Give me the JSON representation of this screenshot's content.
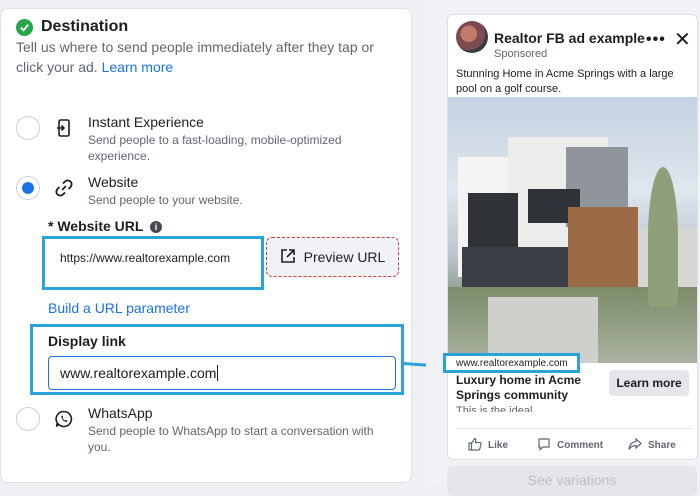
{
  "destination": {
    "title": "Destination",
    "description": "Tell us where to send people immediately after they tap or click your ad.",
    "learn_more": "Learn more"
  },
  "options": [
    {
      "label": "Instant Experience",
      "sub": "Send people to a fast-loading, mobile-optimized experience.",
      "icon": "instant-experience-icon",
      "selected": false
    },
    {
      "label": "Website",
      "sub": "Send people to your website.",
      "icon": "link-icon",
      "selected": true
    },
    {
      "label": "WhatsApp",
      "sub": "Send people to WhatsApp to start a conversation with you.",
      "icon": "whatsapp-icon",
      "selected": false
    }
  ],
  "website_url": {
    "label": "* Website URL",
    "value": "https://www.realtorexample.com",
    "preview_label": "Preview URL",
    "build_param": "Build a URL parameter"
  },
  "display_link": {
    "label": "Display link",
    "value": "www.realtorexample.com"
  },
  "ad_preview": {
    "page_name": "Realtor FB ad example",
    "sponsored": "Sponsored",
    "body": "Stunning Home in Acme Springs with a large pool on a golf course.",
    "display_url": "www.realtorexample.com",
    "headline": "Luxury home in Acme Springs community",
    "description": "This is the ideal...",
    "cta": "Learn more",
    "actions": {
      "like": "Like",
      "comment": "Comment",
      "share": "Share"
    }
  },
  "see_variations": "See variations",
  "colors": {
    "accent": "#1b74e4",
    "highlight": "#29a3d9",
    "check": "#2aa64a"
  }
}
